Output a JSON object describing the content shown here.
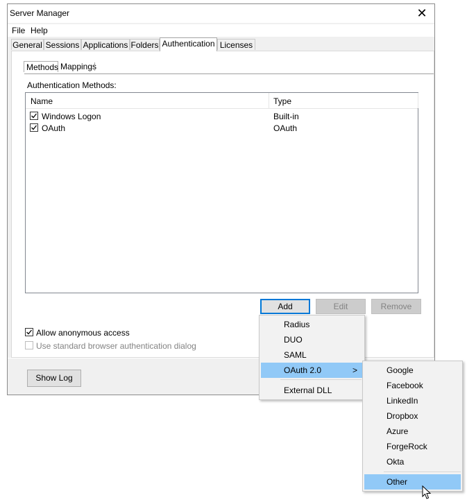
{
  "window": {
    "title": "Server Manager",
    "close_glyph": "✕"
  },
  "menubar": {
    "items": [
      "File",
      "Help"
    ]
  },
  "tabs": [
    "General",
    "Sessions",
    "Applications",
    "Folders",
    "Authentication",
    "Licenses"
  ],
  "active_tab": "Authentication",
  "subtabs": [
    "Methods",
    "Mappings"
  ],
  "active_subtab": "Methods",
  "auth_methods": {
    "label": "Authentication Methods:",
    "columns": [
      "Name",
      "Type"
    ],
    "rows": [
      {
        "name": "Windows Logon",
        "type": "Built-in",
        "checked": true
      },
      {
        "name": "OAuth",
        "type": "OAuth",
        "checked": true
      }
    ]
  },
  "buttons": {
    "add": "Add",
    "edit": "Edit",
    "remove": "Remove",
    "show_log": "Show Log"
  },
  "options": {
    "allow_anonymous": {
      "label": "Allow anonymous access",
      "checked": true
    },
    "std_browser_auth": {
      "label": "Use standard browser authentication dialog",
      "checked": false,
      "enabled": false
    }
  },
  "add_menu": {
    "items": [
      "Radius",
      "DUO",
      "SAML",
      "OAuth 2.0",
      "External DLL"
    ],
    "highlighted": "OAuth 2.0",
    "submenu_arrow": ">"
  },
  "oauth_submenu": {
    "items": [
      "Google",
      "Facebook",
      "LinkedIn",
      "Dropbox",
      "Azure",
      "ForgeRock",
      "Okta",
      "Other"
    ],
    "highlighted": "Other"
  },
  "colors": {
    "highlight": "#91c9f7",
    "window_bg": "#f0f0f0",
    "default_button_border": "#0078d7"
  },
  "icons": {
    "checkbox_check": "check-icon",
    "close": "close-icon",
    "cursor": "mouse-pointer-icon",
    "submenu": "chevron-right-icon"
  }
}
